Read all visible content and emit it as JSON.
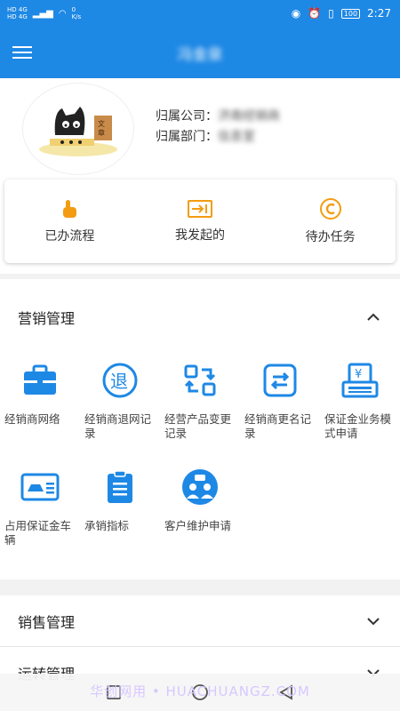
{
  "status_bar": {
    "sim1": "HD 4G",
    "sim2": "HD 4G",
    "net_speed": "0",
    "net_unit": "K/s",
    "battery": "100",
    "time": "2:27"
  },
  "app_bar": {
    "title": "冯金泉"
  },
  "profile": {
    "company_label": "归属公司：",
    "company_value": "济南经销商",
    "department_label": "归属部门：",
    "department_value": "信息室"
  },
  "quick_actions": [
    {
      "label": "已办流程",
      "icon": "hand-pointer-icon",
      "color": "#f39c12"
    },
    {
      "label": "我发起的",
      "icon": "send-box-icon",
      "color": "#f39c12"
    },
    {
      "label": "待办任务",
      "icon": "copyright-circle-icon",
      "color": "#f39c12"
    }
  ],
  "marketing": {
    "title": "营销管理",
    "items": [
      {
        "label": "经销商网络",
        "icon": "briefcase-icon"
      },
      {
        "label": "经销商退网记录",
        "icon": "exit-circle-icon"
      },
      {
        "label": "经营产品变更记录",
        "icon": "exchange-arrows-icon"
      },
      {
        "label": "经销商更名记录",
        "icon": "rename-swap-icon"
      },
      {
        "label": "保证金业务模式申请",
        "icon": "yen-register-icon"
      },
      {
        "label": "占用保证金车辆",
        "icon": "vehicle-card-icon"
      },
      {
        "label": "承销指标",
        "icon": "clipboard-list-icon"
      },
      {
        "label": "客户维护申请",
        "icon": "customer-chat-icon"
      }
    ]
  },
  "sections": [
    {
      "title": "销售管理"
    },
    {
      "title": "运转管理"
    }
  ],
  "watermark": "华创网用 • HUACHUANGZ.COM",
  "colors": {
    "primary": "#1e88e5",
    "accent": "#f39c12",
    "icon_blue": "#1e88e5"
  }
}
